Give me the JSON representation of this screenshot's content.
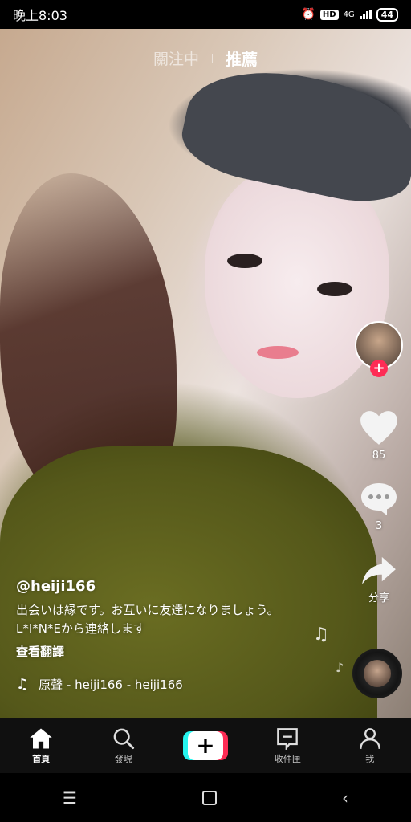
{
  "status_bar": {
    "time": "晚上8:03",
    "network": "4G",
    "hd": "HD",
    "battery": "44"
  },
  "top_tabs": {
    "following": "關注中",
    "for_you": "推薦"
  },
  "rail": {
    "like_count": "85",
    "comment_count": "3",
    "share_label": "分享"
  },
  "post": {
    "handle": "@heiji166",
    "caption": "出会いは縁です。お互いに友達になりましょう。L*I*N*Eから連絡します",
    "translate": "查看翻譯",
    "music": "原聲 - heiji166 - heiji166"
  },
  "bottom_nav": {
    "home": "首頁",
    "discover": "發現",
    "create": "+",
    "inbox": "收件匣",
    "me": "我"
  },
  "colors": {
    "accent_red": "#fe2c55",
    "accent_cyan": "#25f4ee"
  },
  "icons": [
    "alarm-icon",
    "signal-icon",
    "battery-icon",
    "heart-icon",
    "comment-icon",
    "share-icon",
    "music-note-icon",
    "home-icon",
    "search-icon",
    "inbox-icon",
    "person-icon"
  ]
}
